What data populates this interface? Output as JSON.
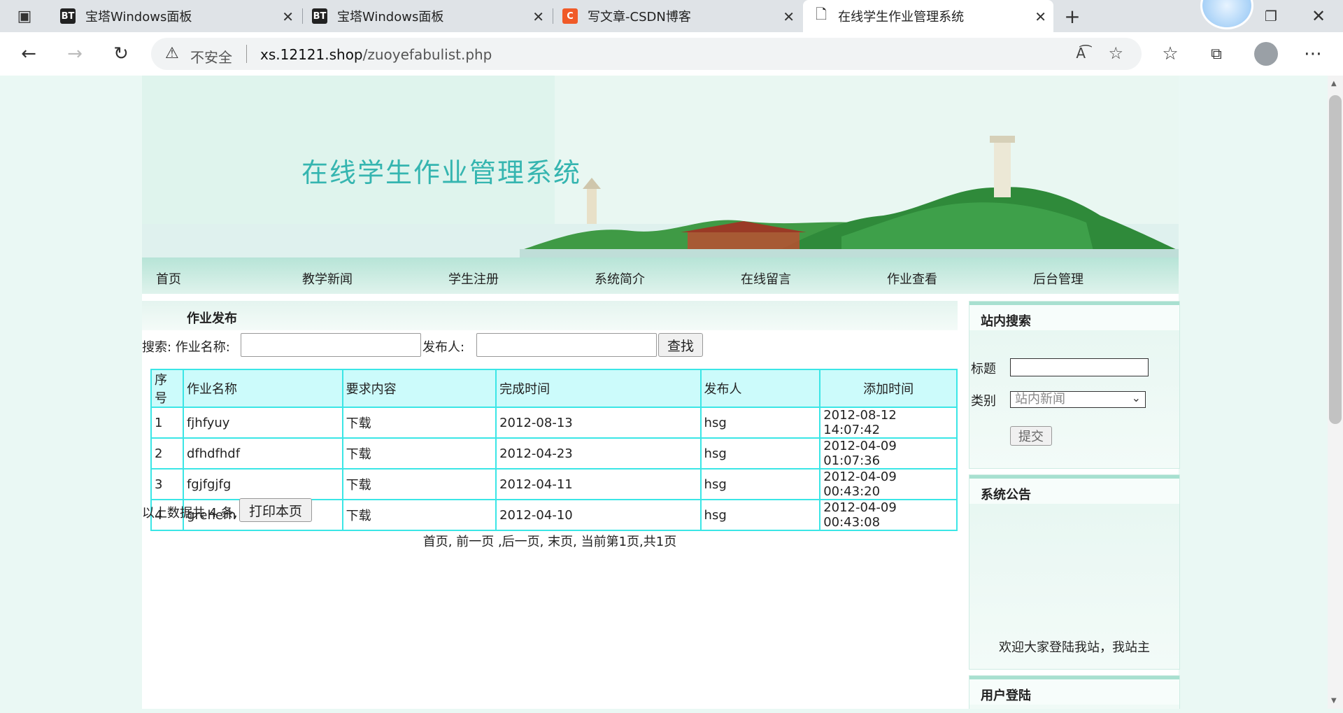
{
  "browser": {
    "tabs": [
      {
        "label": "宝塔Windows面板",
        "icon_text": "BT"
      },
      {
        "label": "宝塔Windows面板",
        "icon_text": "BT"
      },
      {
        "label": "写文章-CSDN博客",
        "icon_text": "C"
      },
      {
        "label": "在线学生作业管理系统",
        "icon_text": ""
      }
    ],
    "security_label": "不安全",
    "url_host": "xs.12121.shop",
    "url_path": "/zuoyefabulist.php"
  },
  "site": {
    "title": "在线学生作业管理系统",
    "menu": [
      "首页",
      "教学新闻",
      "学生注册",
      "系统简介",
      "在线留言",
      "作业查看",
      "后台管理"
    ]
  },
  "main": {
    "section_title": "作业发布",
    "search_label": "搜索: 作业名称:",
    "publisher_label": "发布人:",
    "search_button": "查找",
    "table": {
      "headers": [
        "序号",
        "作业名称",
        "要求内容",
        "完成时间",
        "发布人",
        "添加时间"
      ],
      "rows": [
        [
          "1",
          "fjhfyuy",
          "下载",
          "2012-08-13",
          "hsg",
          "2012-08-12 14:07:42"
        ],
        [
          "2",
          "dfhdfhdf",
          "下载",
          "2012-04-23",
          "hsg",
          "2012-04-09 01:07:36"
        ],
        [
          "3",
          "fgjfgjfg",
          "下载",
          "2012-04-11",
          "hsg",
          "2012-04-09 00:43:20"
        ],
        [
          "4",
          "greherh",
          "下载",
          "2012-04-10",
          "hsg",
          "2012-04-09 00:43:08"
        ]
      ]
    },
    "summary": "以上数据共 4 条,",
    "print_button": "打印本页",
    "pager": "首页, 前一页 ,后一页, 末页, 当前第1页,共1页"
  },
  "sidebar": {
    "search_title": "站内搜索",
    "title_label": "标题",
    "category_label": "类别",
    "category_value": "站内新闻",
    "submit_button": "提交",
    "notice_title": "系统公告",
    "notice_text": "欢迎大家登陆我站，我站主",
    "login_title": "用户登陆"
  }
}
